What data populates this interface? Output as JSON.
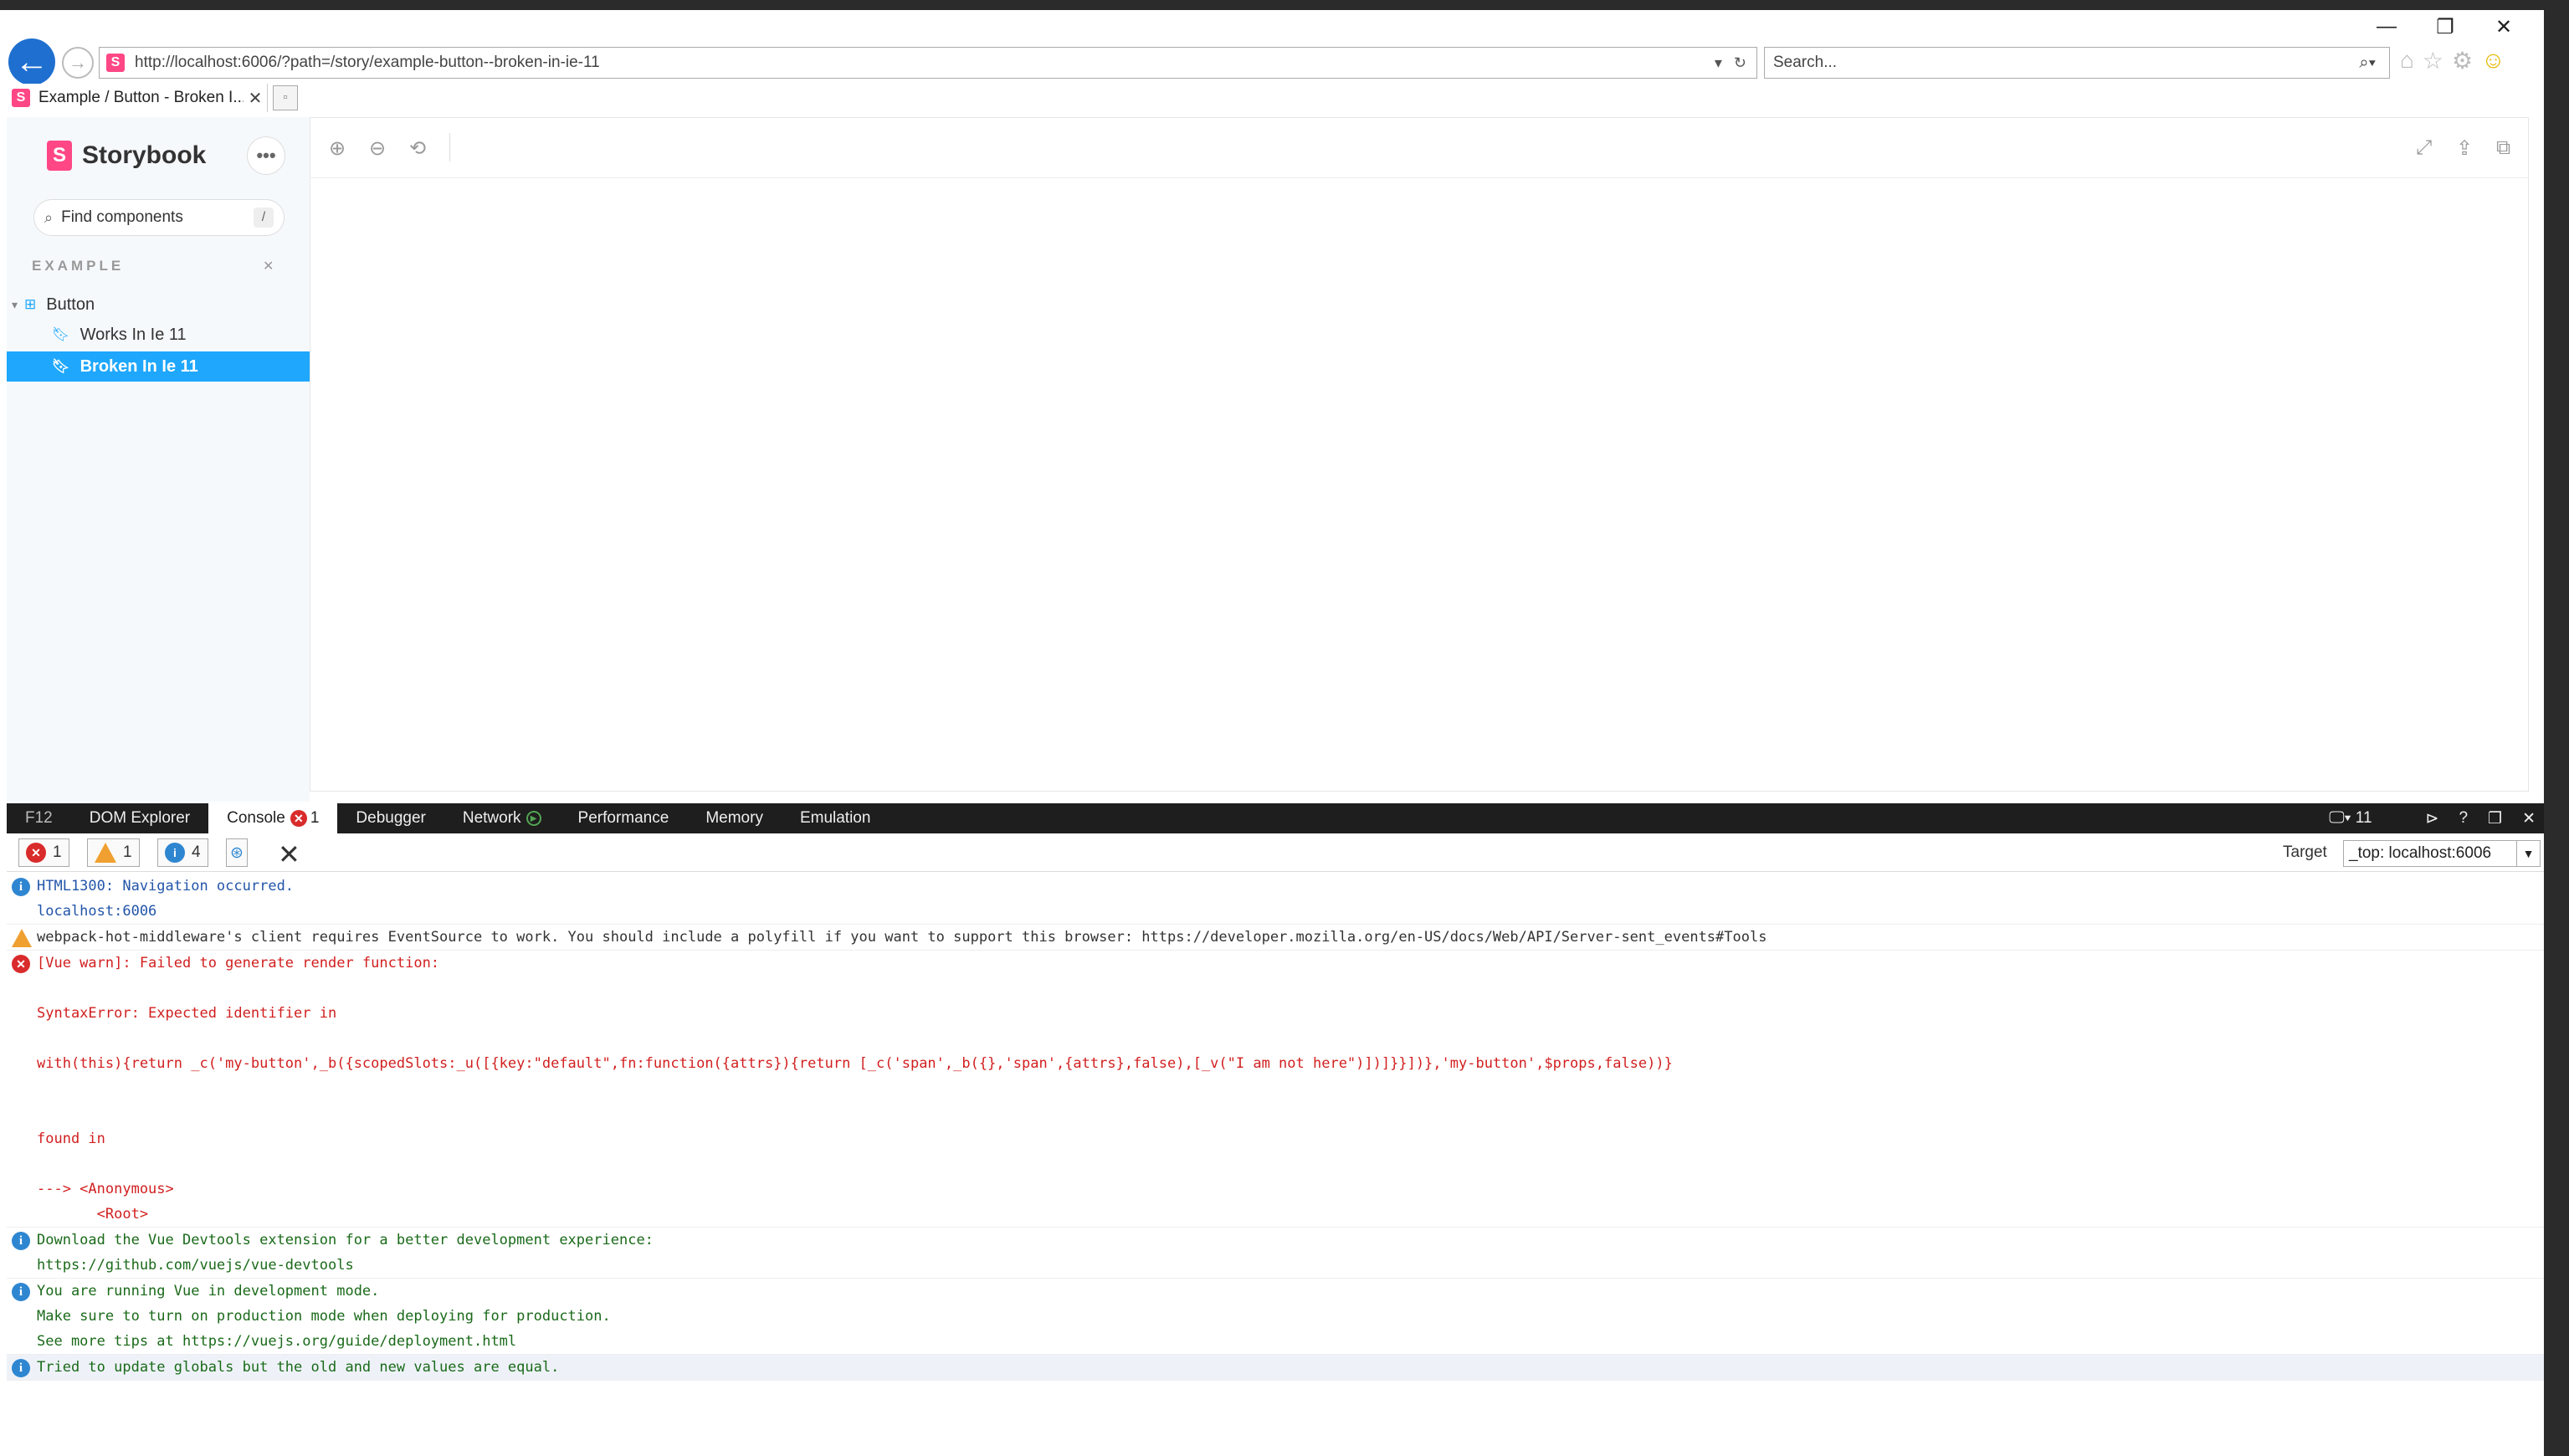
{
  "browser": {
    "window_controls": {
      "minimize": "—",
      "restore": "❐",
      "close": "✕"
    },
    "address_url": "http://localhost:6006/?path=/story/example-button--broken-in-ie-11",
    "search_placeholder": "Search...",
    "tab_title": "Example / Button - Broken I...",
    "tab_close": "✕"
  },
  "storybook": {
    "logo_text": "Storybook",
    "logo_mark": "S",
    "menu_glyph": "•••",
    "search_placeholder": "Find components",
    "search_shortcut": "/",
    "section_title": "EXAMPLE",
    "tree": {
      "component": "Button",
      "stories": [
        {
          "label": "Works In Ie 11",
          "selected": false
        },
        {
          "label": "Broken In Ie 11",
          "selected": true
        }
      ]
    }
  },
  "devtools": {
    "tabs": [
      "F12",
      "DOM Explorer",
      "Console",
      "Debugger",
      "Network",
      "Performance",
      "Memory",
      "Emulation"
    ],
    "console_error_count": "1",
    "right_mode": "11",
    "filters": {
      "errors": "1",
      "warnings": "1",
      "info": "4"
    },
    "target_label": "Target",
    "target_value": "_top: localhost:6006"
  },
  "console": {
    "messages": [
      {
        "type": "info",
        "lines": [
          "HTML1300: Navigation occurred.",
          "localhost:6006"
        ]
      },
      {
        "type": "warn",
        "lines": [
          "webpack-hot-middleware's client requires EventSource to work. You should include a polyfill if you want to support this browser: https://developer.mozilla.org/en-US/docs/Web/API/Server-sent_events#Tools"
        ]
      },
      {
        "type": "error",
        "lines": [
          "[Vue warn]: Failed to generate render function:",
          "",
          "SyntaxError: Expected identifier in",
          "",
          "with(this){return _c('my-button',_b({scopedSlots:_u([{key:\"default\",fn:function({attrs}){return [_c('span',_b({},'span',{attrs},false),[_v(\"I am not here\")])]}}])},'my-button',$props,false))}",
          "",
          "",
          "found in",
          "",
          "---> <Anonymous>",
          "       <Root>"
        ]
      },
      {
        "type": "info",
        "lines": [
          "Download the Vue Devtools extension for a better development experience:",
          "https://github.com/vuejs/vue-devtools"
        ]
      },
      {
        "type": "info",
        "lines": [
          "You are running Vue in development mode.",
          "Make sure to turn on production mode when deploying for production.",
          "See more tips at https://vuejs.org/guide/deployment.html"
        ]
      },
      {
        "type": "info",
        "lines": [
          "Tried to update globals but the old and new values are equal."
        ],
        "highlight": true
      }
    ]
  },
  "colors": {
    "accent": "#1ea7fd",
    "storybook_pink": "#ff4785",
    "error": "#d21f1f",
    "info": "#2e86d1"
  }
}
